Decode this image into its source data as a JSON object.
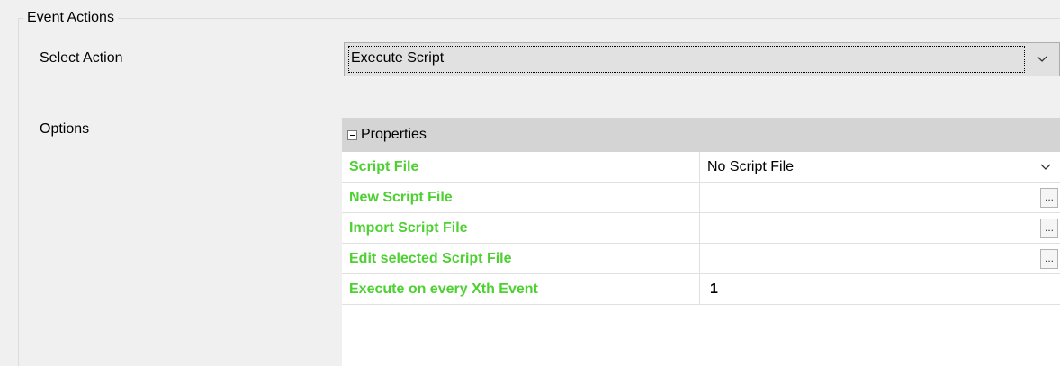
{
  "group": {
    "title": "Event Actions"
  },
  "select_action": {
    "label": "Select Action",
    "value": "Execute Script",
    "icon": "chevron-down-icon"
  },
  "options": {
    "label": "Options",
    "category": "Properties",
    "rows": [
      {
        "name": "Script File",
        "value": "No Script File",
        "editor": "dropdown"
      },
      {
        "name": "New Script File",
        "value": "",
        "editor": "ellipsis",
        "button_label": "..."
      },
      {
        "name": "Import Script File",
        "value": "",
        "editor": "ellipsis",
        "button_label": "..."
      },
      {
        "name": "Edit selected Script File",
        "value": "",
        "editor": "ellipsis",
        "button_label": "..."
      },
      {
        "name": "Execute on every Xth Event",
        "value": "1",
        "editor": "text"
      }
    ]
  },
  "colors": {
    "property_name": "#4cd131",
    "category_bg": "#d4d4d4",
    "window_bg": "#f0f0f0"
  }
}
